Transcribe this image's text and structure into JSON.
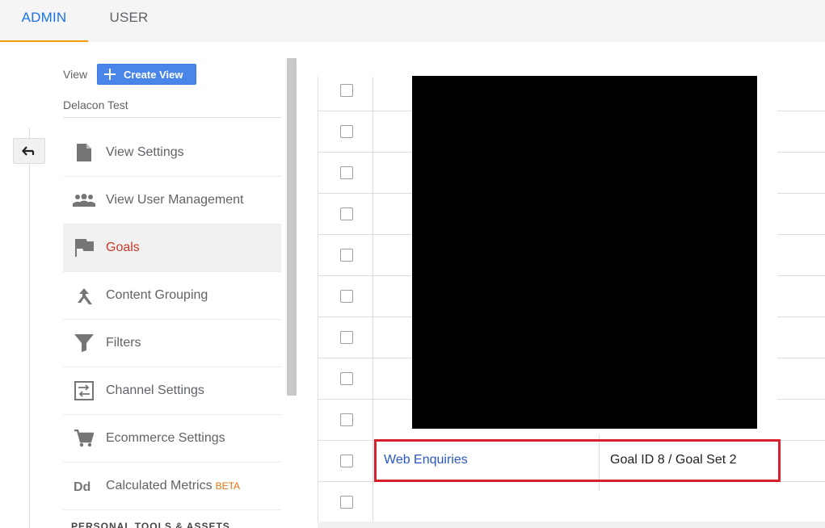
{
  "tabs": [
    {
      "label": "ADMIN",
      "active": true
    },
    {
      "label": "USER",
      "active": false
    }
  ],
  "view": {
    "label": "View",
    "create_button": "Create View",
    "name": "Delacon Test"
  },
  "nav": {
    "items": [
      {
        "label": "View Settings",
        "icon": "document-icon"
      },
      {
        "label": "View User Management",
        "icon": "people-icon"
      },
      {
        "label": "Goals",
        "icon": "flag-icon",
        "active": true
      },
      {
        "label": "Content Grouping",
        "icon": "merge-icon"
      },
      {
        "label": "Filters",
        "icon": "filter-icon"
      },
      {
        "label": "Channel Settings",
        "icon": "channel-icon"
      },
      {
        "label": "Ecommerce Settings",
        "icon": "cart-icon"
      },
      {
        "label": "Calculated Metrics",
        "icon": "dd-icon",
        "badge": "BETA"
      }
    ],
    "section_heading": "PERSONAL TOOLS & ASSETS"
  },
  "goal_row": {
    "name": "Web Enquiries",
    "id": "Goal ID 8 / Goal Set 2"
  },
  "colors": {
    "accent_blue": "#1a73e8",
    "active_red": "#c53929",
    "highlight": "#d9202d",
    "beta": "#e8710a"
  }
}
